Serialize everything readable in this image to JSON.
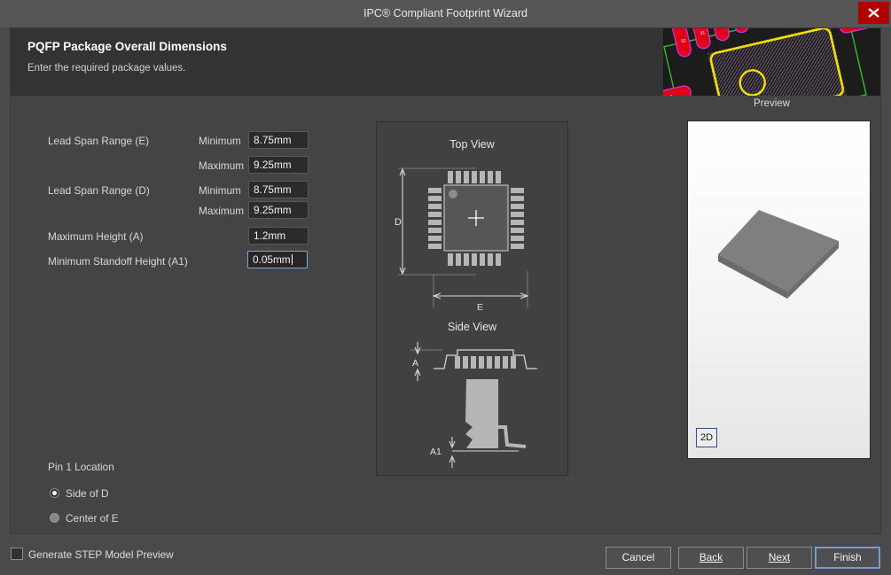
{
  "window": {
    "title": "IPC® Compliant Footprint Wizard",
    "close_icon": "close-icon"
  },
  "header": {
    "title": "PQFP Package Overall Dimensions",
    "subtitle": "Enter the required package values.",
    "preview_caption": "Preview"
  },
  "form": {
    "rows": [
      {
        "label": "Lead Span Range (E)",
        "sub": "Minimum",
        "value": "8.75mm",
        "focused": false
      },
      {
        "label": "",
        "sub": "Maximum",
        "value": "9.25mm",
        "focused": false
      },
      {
        "label": "Lead Span Range (D)",
        "sub": "Minimum",
        "value": "8.75mm",
        "focused": false
      },
      {
        "label": "",
        "sub": "Maximum",
        "value": "9.25mm",
        "focused": false
      },
      {
        "label": "Maximum Height (A)",
        "sub": "",
        "value": "1.2mm",
        "focused": false
      },
      {
        "label": "Minimum Standoff Height (A1)",
        "sub": "",
        "value": "0.05mm",
        "focused": true
      }
    ],
    "pin1_title": "Pin 1 Location",
    "pin1_options": [
      {
        "label": "Side of D",
        "selected": true
      },
      {
        "label": "Center of E",
        "selected": false
      }
    ]
  },
  "diagram": {
    "top_view_title": "Top View",
    "side_view_title": "Side View",
    "labels": {
      "d": "D",
      "e": "E",
      "a": "A",
      "a1": "A1"
    }
  },
  "preview3d": {
    "toggle_label": "2D"
  },
  "footer": {
    "checkbox_label": "Generate STEP Model Preview",
    "checkbox_checked": false,
    "buttons": [
      {
        "label": "Cancel",
        "accel": "",
        "primary": false
      },
      {
        "label": "Back",
        "accel": "B",
        "primary": false
      },
      {
        "label": "Next",
        "accel": "N",
        "primary": false
      },
      {
        "label": "Finish",
        "accel": "",
        "primary": true
      }
    ]
  },
  "colors": {
    "window_bg": "#4a4a4a",
    "titlebar": "#555555",
    "panel_bg": "#444444",
    "header_band": "#333333",
    "field_bg": "#2b2b2b",
    "focus_border": "#7fa8d4",
    "close_btn": "#b20000",
    "pad_red": "#e00018",
    "silk_yellow": "#f0e000",
    "outline_magenta": "#cc33cc",
    "courtyard_green": "#33bb33",
    "slab_top": "#808080",
    "slab_side": "#666666"
  }
}
